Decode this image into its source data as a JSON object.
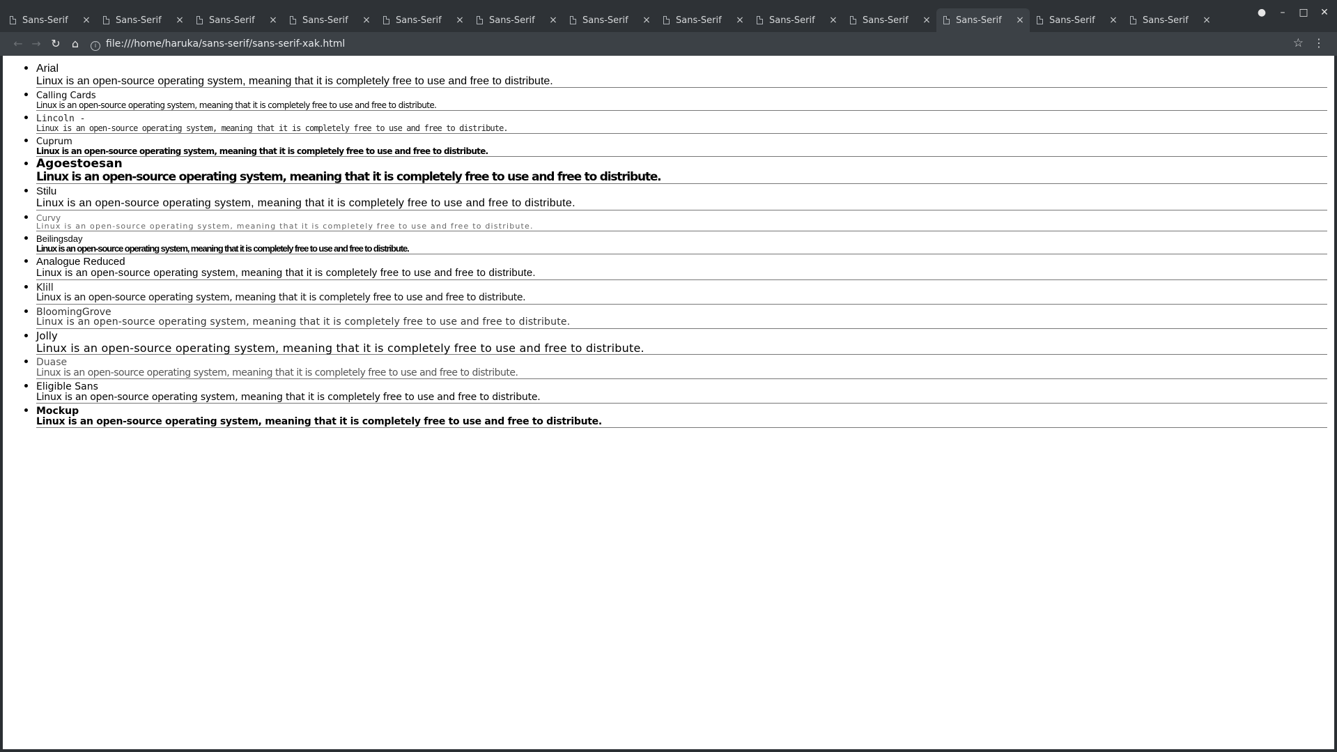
{
  "browser": {
    "tabs": [
      {
        "label": "Sans-Serif",
        "active": false
      },
      {
        "label": "Sans-Serif",
        "active": false
      },
      {
        "label": "Sans-Serif",
        "active": false
      },
      {
        "label": "Sans-Serif",
        "active": false
      },
      {
        "label": "Sans-Serif",
        "active": false
      },
      {
        "label": "Sans-Serif",
        "active": false
      },
      {
        "label": "Sans-Serif",
        "active": false
      },
      {
        "label": "Sans-Serif",
        "active": false
      },
      {
        "label": "Sans-Serif",
        "active": false
      },
      {
        "label": "Sans-Serif",
        "active": false
      },
      {
        "label": "Sans-Serif",
        "active": true
      },
      {
        "label": "Sans-Serif",
        "active": false
      },
      {
        "label": "Sans-Serif",
        "active": false
      }
    ],
    "tab_close_glyph": "×",
    "url": "file:///home/haruka/sans-serif/sans-serif-xak.html"
  },
  "page": {
    "sample_text": "Linux is an open-source operating system, meaning that it is completely free to use and free to distribute.",
    "fonts": [
      {
        "name": "Arial"
      },
      {
        "name": "Calling Cards"
      },
      {
        "name": "Lincoln -"
      },
      {
        "name": "Cuprum"
      },
      {
        "name": "Agoestoesan"
      },
      {
        "name": "Stilu"
      },
      {
        "name": "Curvy"
      },
      {
        "name": "Beilingsday"
      },
      {
        "name": "Analogue Reduced"
      },
      {
        "name": "Klill"
      },
      {
        "name": "BloomingGrove"
      },
      {
        "name": "Jolly"
      },
      {
        "name": "Duase"
      },
      {
        "name": "Eligible Sans"
      },
      {
        "name": "Mockup"
      }
    ]
  },
  "colors": {
    "chrome_bg": "#2e3236",
    "toolbar_bg": "#3c4146",
    "page_bg": "#ffffff",
    "text": "#000000"
  },
  "icons": [
    "document-icon",
    "close-icon",
    "account-icon",
    "minimize-icon",
    "maximize-icon",
    "window-close-icon",
    "back-icon",
    "forward-icon",
    "reload-icon",
    "home-icon",
    "info-icon",
    "star-icon",
    "menu-icon"
  ]
}
